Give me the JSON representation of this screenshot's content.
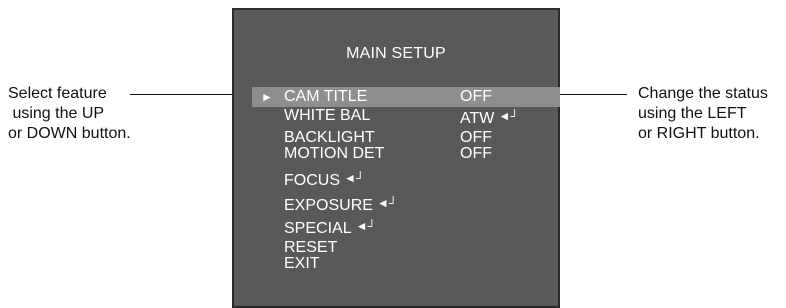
{
  "callouts": {
    "left": [
      "Select feature",
      " using the UP",
      "or DOWN button."
    ],
    "right": [
      "Change the status",
      "using the LEFT",
      "or RIGHT button."
    ]
  },
  "osd": {
    "title": "MAIN SETUP",
    "cursor_icon": "triangle-right-icon",
    "enter_icon": "enter-icon",
    "enter_glyph": "◄┘",
    "cursor_glyph": "►",
    "items": [
      {
        "label": "CAM TITLE",
        "value": "OFF",
        "selected": true
      },
      {
        "label": "WHITE BAL",
        "value": "ATW",
        "value_submenu": true
      },
      {
        "label": "BACKLIGHT",
        "value": "OFF"
      },
      {
        "label": "MOTION DET",
        "value": "OFF"
      },
      {
        "label": "FOCUS",
        "submenu": true
      },
      {
        "label": "EXPOSURE",
        "submenu": true
      },
      {
        "label": "SPECIAL",
        "submenu": true
      },
      {
        "label": "RESET"
      },
      {
        "label": "EXIT"
      }
    ]
  },
  "colors": {
    "panel_bg": "#595959",
    "highlight": "#8e8e8e",
    "text": "#ffffff"
  }
}
